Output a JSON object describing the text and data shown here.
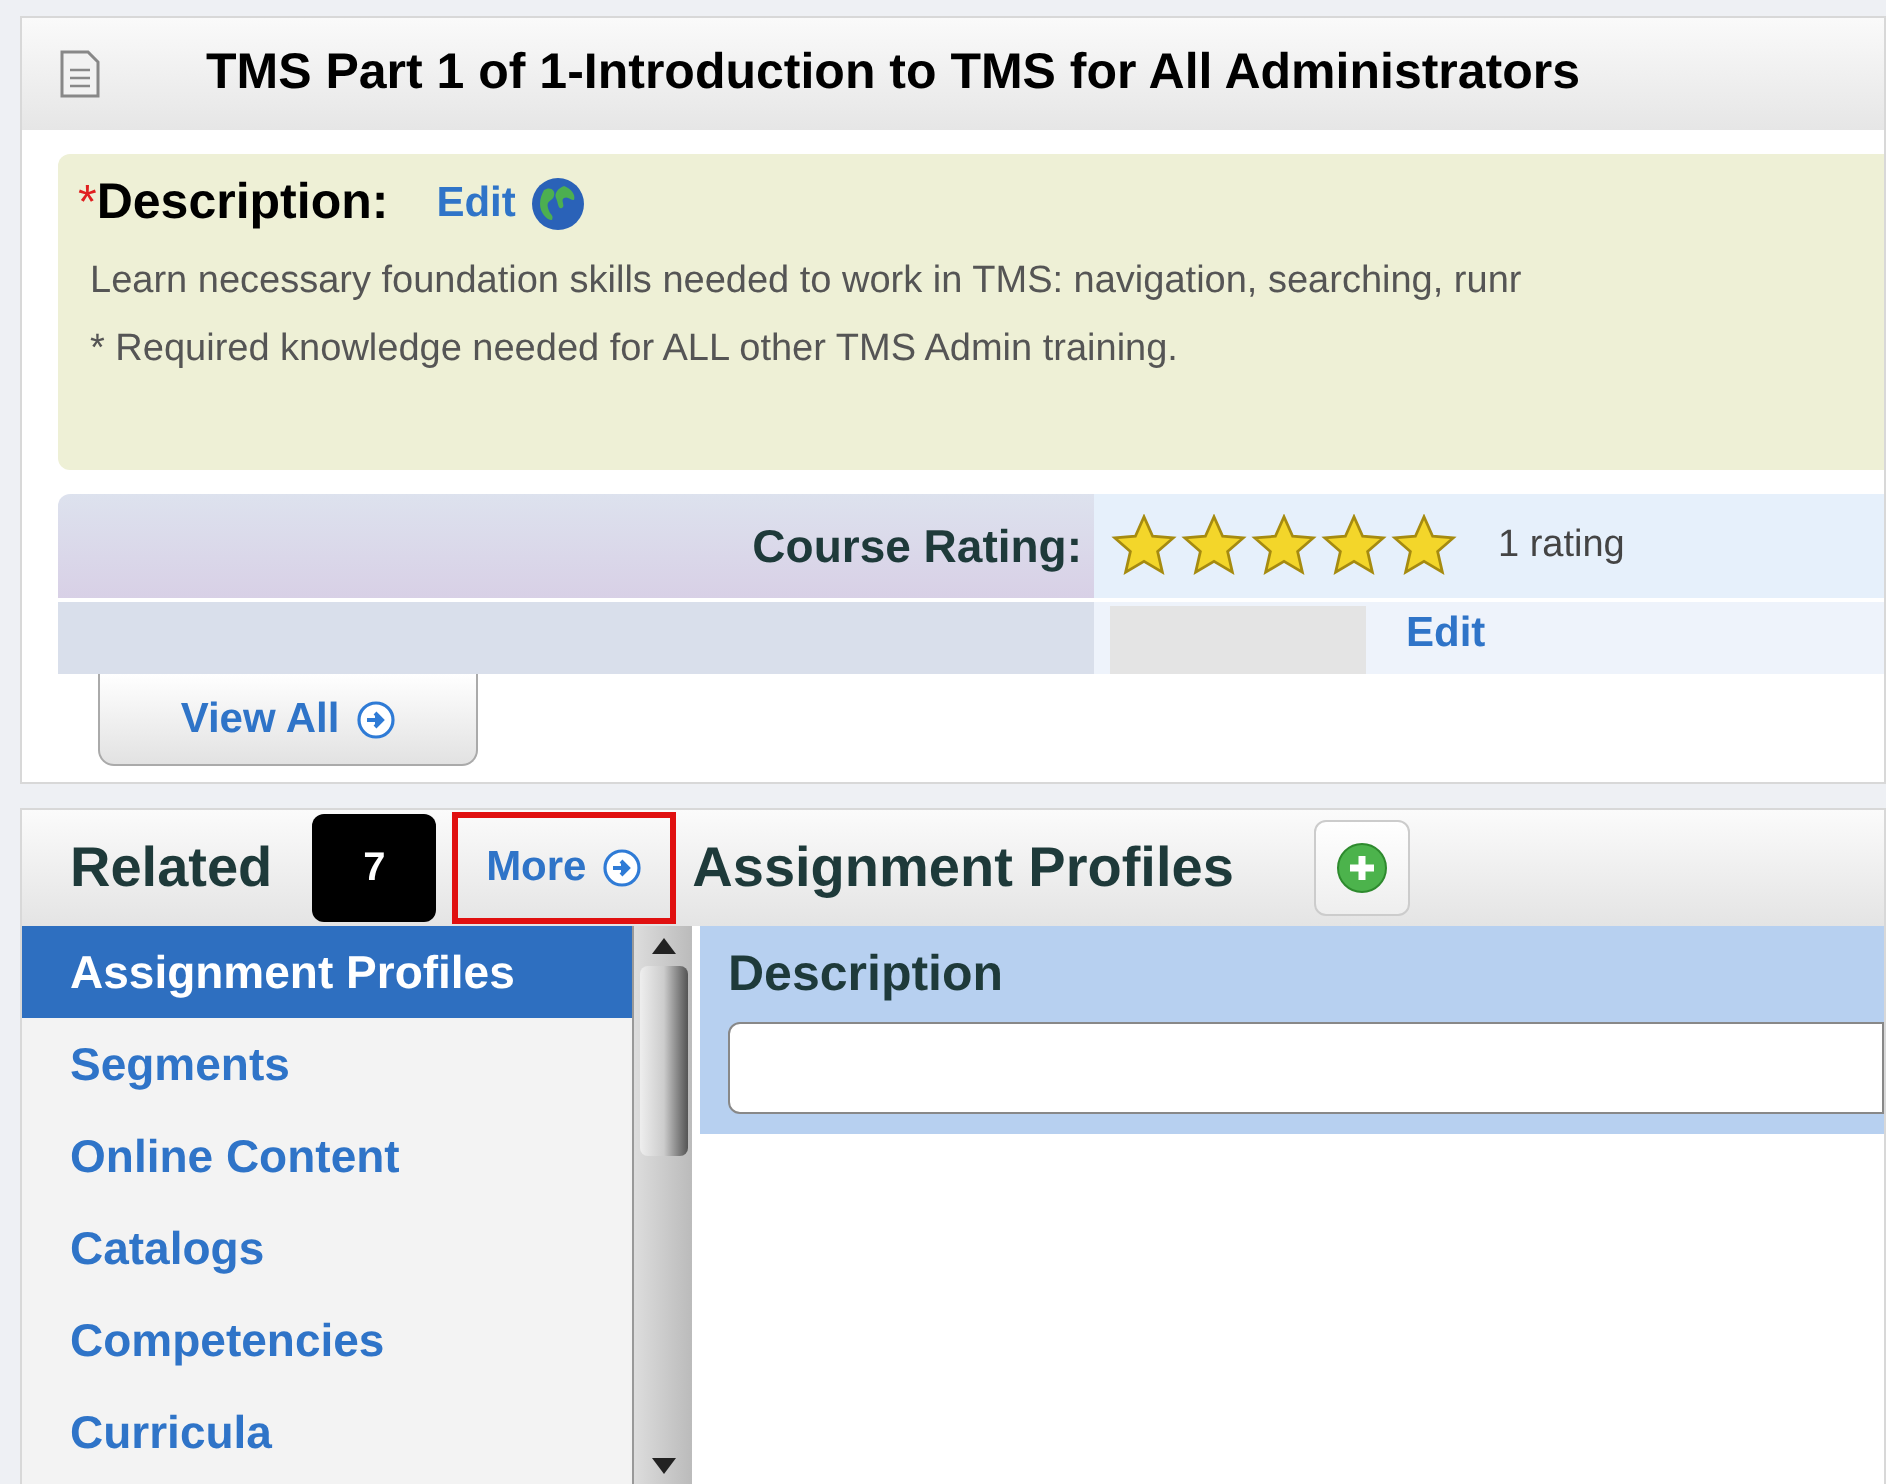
{
  "header": {
    "title": "TMS Part 1 of 1-Introduction to TMS for All Administrators"
  },
  "description": {
    "required_mark": "*",
    "label": "Description:",
    "edit": "Edit",
    "lines": [
      "Learn necessary foundation skills needed to work in TMS: navigation, searching, runr",
      "* Required knowledge needed for ALL other TMS Admin training."
    ]
  },
  "rating": {
    "label": "Course Rating:",
    "stars": 5,
    "count": "1 rating",
    "edit": "Edit"
  },
  "view_all": "View All",
  "related": {
    "title": "Related",
    "callout": "7",
    "more": "More",
    "more_highlighted": true,
    "items": [
      {
        "label": "Assignment Profiles",
        "selected": true
      },
      {
        "label": "Segments",
        "selected": false
      },
      {
        "label": "Online Content",
        "selected": false
      },
      {
        "label": "Catalogs",
        "selected": false
      },
      {
        "label": "Competencies",
        "selected": false
      },
      {
        "label": "Curricula",
        "selected": false
      }
    ]
  },
  "panel": {
    "title": "Assignment Profiles",
    "column": "Description"
  }
}
